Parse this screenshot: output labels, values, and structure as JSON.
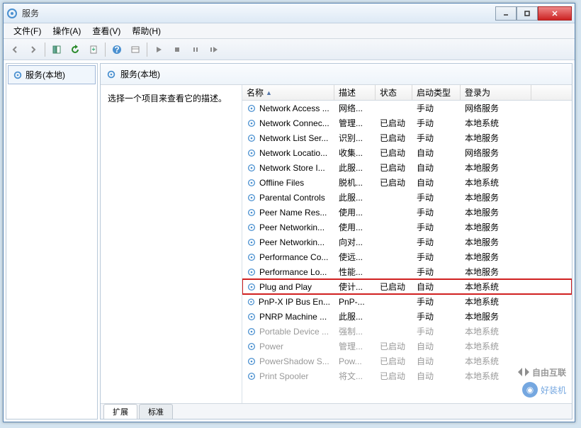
{
  "window": {
    "title": "服务"
  },
  "menubar": [
    {
      "label": "文件(F)"
    },
    {
      "label": "操作(A)"
    },
    {
      "label": "查看(V)"
    },
    {
      "label": "帮助(H)"
    }
  ],
  "nav": {
    "item": "服务(本地)"
  },
  "main_header": "服务(本地)",
  "desc_hint": "选择一个项目来查看它的描述。",
  "columns": {
    "name": "名称",
    "desc": "描述",
    "status": "状态",
    "startup": "启动类型",
    "logon": "登录为"
  },
  "services": [
    {
      "name": "Network Access ...",
      "desc": "网络...",
      "status": "",
      "startup": "手动",
      "logon": "网络服务",
      "highlight": false,
      "dim": false
    },
    {
      "name": "Network Connec...",
      "desc": "管理...",
      "status": "已启动",
      "startup": "手动",
      "logon": "本地系统",
      "highlight": false,
      "dim": false
    },
    {
      "name": "Network List Ser...",
      "desc": "识别...",
      "status": "已启动",
      "startup": "手动",
      "logon": "本地服务",
      "highlight": false,
      "dim": false
    },
    {
      "name": "Network Locatio...",
      "desc": "收集...",
      "status": "已启动",
      "startup": "自动",
      "logon": "网络服务",
      "highlight": false,
      "dim": false
    },
    {
      "name": "Network Store I...",
      "desc": "此服...",
      "status": "已启动",
      "startup": "自动",
      "logon": "本地服务",
      "highlight": false,
      "dim": false
    },
    {
      "name": "Offline Files",
      "desc": "脱机...",
      "status": "已启动",
      "startup": "自动",
      "logon": "本地系统",
      "highlight": false,
      "dim": false
    },
    {
      "name": "Parental Controls",
      "desc": "此服...",
      "status": "",
      "startup": "手动",
      "logon": "本地服务",
      "highlight": false,
      "dim": false
    },
    {
      "name": "Peer Name Res...",
      "desc": "使用...",
      "status": "",
      "startup": "手动",
      "logon": "本地服务",
      "highlight": false,
      "dim": false
    },
    {
      "name": "Peer Networkin...",
      "desc": "使用...",
      "status": "",
      "startup": "手动",
      "logon": "本地服务",
      "highlight": false,
      "dim": false
    },
    {
      "name": "Peer Networkin...",
      "desc": "向对...",
      "status": "",
      "startup": "手动",
      "logon": "本地服务",
      "highlight": false,
      "dim": false
    },
    {
      "name": "Performance Co...",
      "desc": "使远...",
      "status": "",
      "startup": "手动",
      "logon": "本地服务",
      "highlight": false,
      "dim": false
    },
    {
      "name": "Performance Lo...",
      "desc": "性能...",
      "status": "",
      "startup": "手动",
      "logon": "本地服务",
      "highlight": false,
      "dim": false
    },
    {
      "name": "Plug and Play",
      "desc": "使计...",
      "status": "已启动",
      "startup": "自动",
      "logon": "本地系统",
      "highlight": true,
      "dim": false
    },
    {
      "name": "PnP-X IP Bus En...",
      "desc": "PnP-...",
      "status": "",
      "startup": "手动",
      "logon": "本地系统",
      "highlight": false,
      "dim": false
    },
    {
      "name": "PNRP Machine ...",
      "desc": "此服...",
      "status": "",
      "startup": "手动",
      "logon": "本地服务",
      "highlight": false,
      "dim": false
    },
    {
      "name": "Portable Device ...",
      "desc": "强制...",
      "status": "",
      "startup": "手动",
      "logon": "本地系统",
      "highlight": false,
      "dim": true
    },
    {
      "name": "Power",
      "desc": "管理...",
      "status": "已启动",
      "startup": "自动",
      "logon": "本地系统",
      "highlight": false,
      "dim": true
    },
    {
      "name": "PowerShadow S...",
      "desc": "Pow...",
      "status": "已启动",
      "startup": "自动",
      "logon": "本地系统",
      "highlight": false,
      "dim": true
    },
    {
      "name": "Print Spooler",
      "desc": "将文...",
      "status": "已启动",
      "startup": "自动",
      "logon": "本地系统",
      "highlight": false,
      "dim": true
    }
  ],
  "tabs": {
    "extended": "扩展",
    "standard": "标准"
  },
  "watermark1": "自由互联",
  "watermark2": "好装机"
}
